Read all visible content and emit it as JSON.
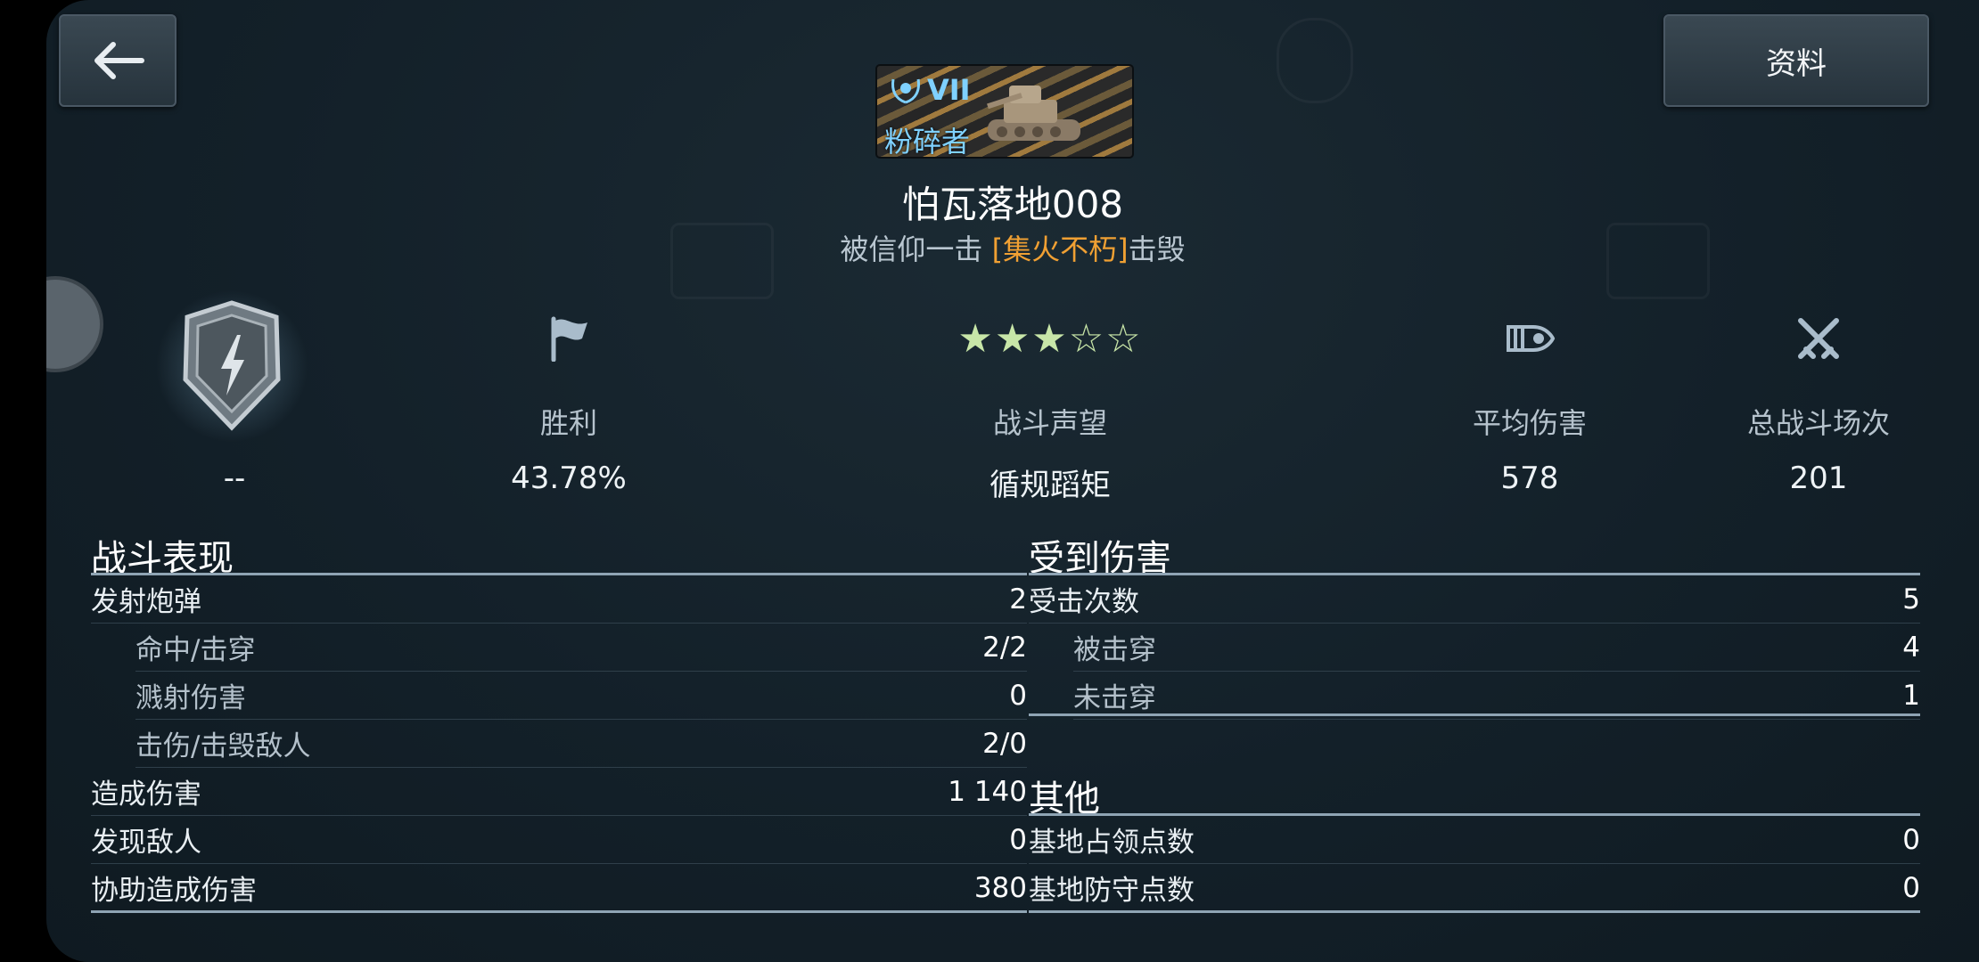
{
  "buttons": {
    "back_icon": "back-arrow-icon",
    "info_label": "资料"
  },
  "badge": {
    "tier": "VII",
    "rank": "粉碎者",
    "tier_icon": "laurel-icon"
  },
  "player": {
    "name": "怕瓦落地008",
    "destroyed_prefix": "被信仰一击 ",
    "destroyed_clan": "[集火不朽]",
    "destroyed_suffix": "击毁"
  },
  "stats": {
    "rating_value": "--",
    "victory": {
      "label": "胜利",
      "value": "43.78%",
      "icon": "flag-icon"
    },
    "reputation": {
      "label": "战斗声望",
      "value": "循规蹈矩",
      "stars_filled": 3,
      "stars_total": 5
    },
    "avg_damage": {
      "label": "平均伤害",
      "value": "578",
      "icon": "shell-icon"
    },
    "battles": {
      "label": "总战斗场次",
      "value": "201",
      "icon": "crossed-swords-icon"
    }
  },
  "performance": {
    "title": "战斗表现",
    "rows": [
      {
        "label": "发射炮弹",
        "value": "2",
        "sub": false
      },
      {
        "label": "命中/击穿",
        "value": "2/2",
        "sub": true
      },
      {
        "label": "溅射伤害",
        "value": "0",
        "sub": true
      },
      {
        "label": "击伤/击毁敌人",
        "value": "2/0",
        "sub": true
      },
      {
        "label": "造成伤害",
        "value": "1 140",
        "sub": false
      },
      {
        "label": "发现敌人",
        "value": "0",
        "sub": false
      },
      {
        "label": "协助造成伤害",
        "value": "380",
        "sub": false
      }
    ]
  },
  "damage_taken": {
    "title": "受到伤害",
    "rows": [
      {
        "label": "受击次数",
        "value": "5",
        "sub": false
      },
      {
        "label": "被击穿",
        "value": "4",
        "sub": true
      },
      {
        "label": "未击穿",
        "value": "1",
        "sub": true
      }
    ]
  },
  "other": {
    "title": "其他",
    "rows": [
      {
        "label": "基地占领点数",
        "value": "0",
        "sub": false
      },
      {
        "label": "基地防守点数",
        "value": "0",
        "sub": false
      }
    ]
  },
  "colors": {
    "accent_orange": "#f0a033",
    "accent_blue": "#7fd1ff",
    "star": "#c8e6a8"
  }
}
